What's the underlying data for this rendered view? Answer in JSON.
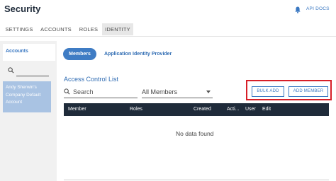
{
  "header": {
    "title": "Security",
    "api_docs_label": "API DOCS"
  },
  "tabs": [
    {
      "label": "SETTINGS",
      "active": false
    },
    {
      "label": "ACCOUNTS",
      "active": false
    },
    {
      "label": "ROLES",
      "active": false
    },
    {
      "label": "IDENTITY",
      "active": true
    }
  ],
  "sidebar": {
    "heading": "Accounts",
    "search_placeholder": "",
    "selected_account": "Andy Sherwin's Company Default Account"
  },
  "subnav": {
    "members_label": "Members",
    "idp_label": "Application Identity Provider"
  },
  "acl": {
    "title": "Access Control List",
    "search_placeholder": "Search",
    "filter_value": "All Members",
    "bulk_add_label": "BULK ADD",
    "add_member_label": "ADD MEMBER",
    "columns": [
      "Member",
      "Roles",
      "Created",
      "Acti...",
      "User",
      "Edit"
    ],
    "empty_text": "No data found"
  },
  "colors": {
    "accent": "#3a78c2",
    "table_header": "#1f2b3a",
    "highlight": "#d71f28"
  },
  "icons": [
    "bell-icon",
    "search-icon",
    "chevron-down-icon"
  ]
}
